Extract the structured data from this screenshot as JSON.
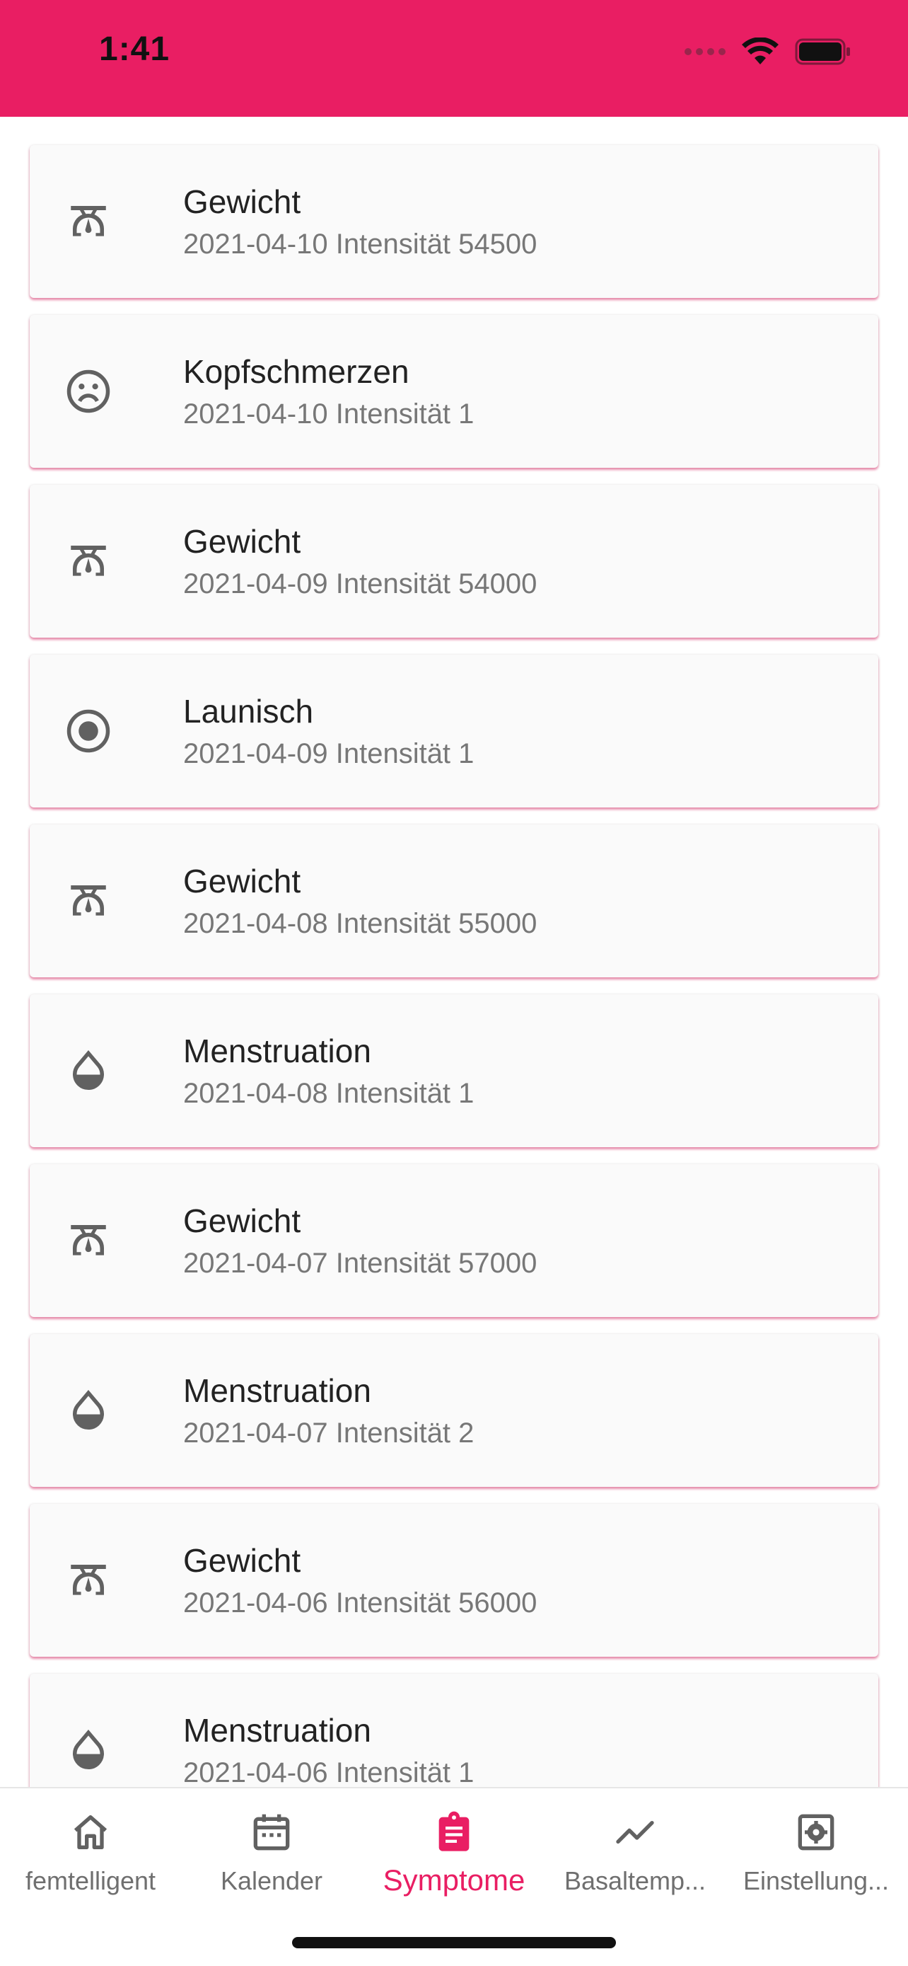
{
  "status_bar": {
    "time": "1:41",
    "background": "#e91e63"
  },
  "accent_color": "#e91e63",
  "entries": [
    {
      "icon": "scale-icon",
      "title": "Gewicht",
      "subtitle": "2021-04-10 Intensität 54500"
    },
    {
      "icon": "sad-face-icon",
      "title": "Kopfschmerzen",
      "subtitle": "2021-04-10 Intensität 1"
    },
    {
      "icon": "scale-icon",
      "title": "Gewicht",
      "subtitle": "2021-04-09 Intensität 54000"
    },
    {
      "icon": "radio-button-icon",
      "title": "Launisch",
      "subtitle": "2021-04-09 Intensität 1"
    },
    {
      "icon": "scale-icon",
      "title": "Gewicht",
      "subtitle": "2021-04-08 Intensität 55000"
    },
    {
      "icon": "drop-icon",
      "title": "Menstruation",
      "subtitle": "2021-04-08 Intensität 1"
    },
    {
      "icon": "scale-icon",
      "title": "Gewicht",
      "subtitle": "2021-04-07 Intensität 57000"
    },
    {
      "icon": "drop-icon",
      "title": "Menstruation",
      "subtitle": "2021-04-07 Intensität 2"
    },
    {
      "icon": "scale-icon",
      "title": "Gewicht",
      "subtitle": "2021-04-06 Intensität 56000"
    },
    {
      "icon": "drop-icon",
      "title": "Menstruation",
      "subtitle": "2021-04-06 Intensität 1"
    }
  ],
  "bottom_nav": [
    {
      "icon": "home-icon",
      "label": "femtelligent",
      "active": false
    },
    {
      "icon": "calendar-icon",
      "label": "Kalender",
      "active": false
    },
    {
      "icon": "clipboard-icon",
      "label": "Symptome",
      "active": true
    },
    {
      "icon": "trend-line-icon",
      "label": "Basaltemp...",
      "active": false
    },
    {
      "icon": "settings-icon",
      "label": "Einstellung...",
      "active": false
    }
  ]
}
